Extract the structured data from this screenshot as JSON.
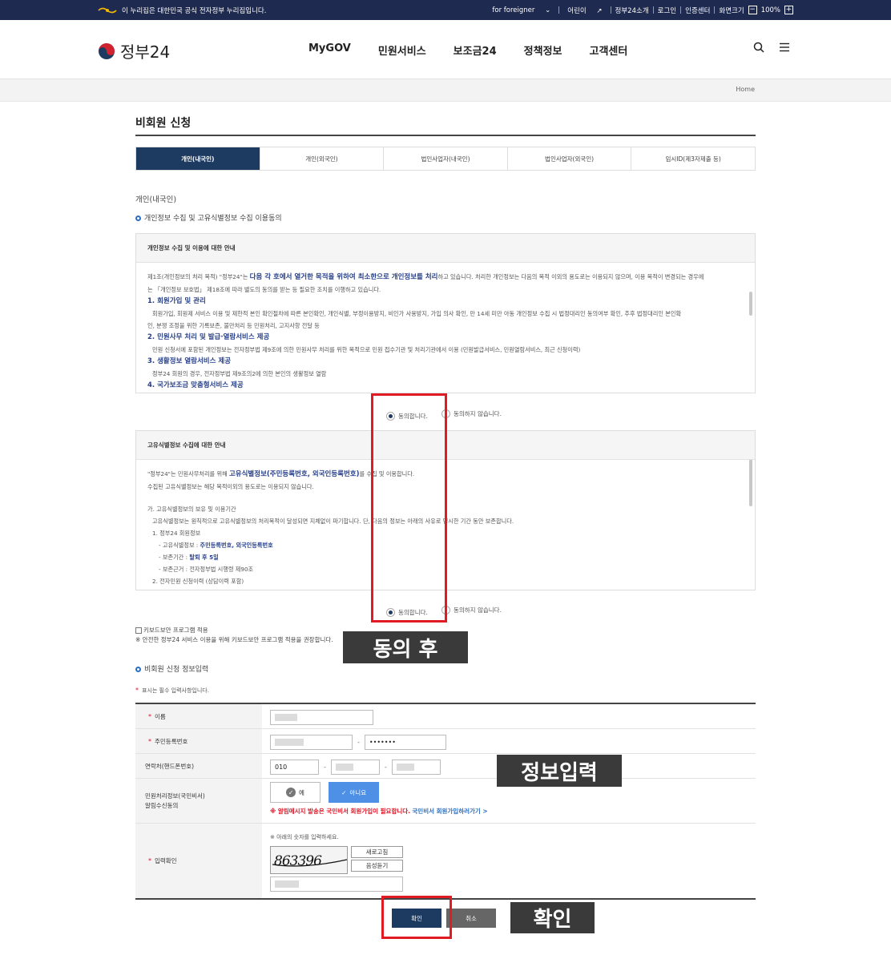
{
  "topbar": {
    "notice": "이 누리집은 대한민국 공식 전자정부 누리집입니다.",
    "foreigner": "for foreigner",
    "kids": "어린이",
    "about": "정부24소개",
    "login": "로그인",
    "cert": "인증센터",
    "zoom_label": "화면크기",
    "zoom_value": "100%",
    "minus": "−",
    "plus": "+"
  },
  "header": {
    "logo": "정부24",
    "menu": [
      "MyGOV",
      "민원서비스",
      "보조금24",
      "정책정보",
      "고객센터"
    ]
  },
  "breadcrumb": "Home",
  "page_title": "비회원 신청",
  "tabs": [
    "개인(내국인)",
    "개인(외국인)",
    "법인사업자(내국인)",
    "법인사업자(외국인)",
    "임시ID(제3자제출 등)"
  ],
  "section": {
    "category": "개인(내국인)",
    "consent_heading": "개인정보 수집 및 고유식별정보 수집 이용동의"
  },
  "box1": {
    "title": "개인정보 수집 및 이용에 대한 안내",
    "p1a": "제1조(개인정보의 처리 목적) \"정부24\"는 ",
    "p1b": "다음 각 호에서 열거한 목적을 위하여 최소한으로 개인정보를 처리",
    "p1c": "하고 있습니다. 처리한 개인정보는 다음의 목적 이외의 용도로는 이용되지 않으며, 이용 목적이 변경되는 경우에",
    "p1d": "는 「개인정보 보호법」 제18조에 따라 별도의 동의를 받는 등 필요한 조치를 이행하고 있습니다.",
    "h1": "1. 회원가입 및 관리",
    "t1a": "회원가입, 회원제 서비스 이용 및 제한적 본인 확인절차에 따른 본인확인, 개인식별, 부정이용방지, 비인가 사용방지, 가입 의사 확인, 만 14세 미만 아동 개인정보 수집 시 법정대리인 동의여부 확인, 추후 법정대리인 본인확",
    "t1b": "인, 분쟁 조정을 위한 기록보존, 불만처리 등 민원처리, 고지사항 전달 등",
    "h2": "2. 민원사무 처리 및 발급·열람서비스 제공",
    "t2": "민원 신청서에 포함된 개인정보는 전자정부법 제9조에 의한 민원사무 처리를 위한 목적으로 민원 접수기관 및 처리기관에서 이용 (민원발급서비스, 민원열람서비스, 최근 신청이력)",
    "h3": "3. 생활정보 열람서비스 제공",
    "t3": "정부24 회원의 경우, 전자정부법 제9조의2에 의한 본인의 생활정보 열람",
    "h4": "4. 국가보조금 맞춤형서비스 제공"
  },
  "box2": {
    "title": "고유식별정보 수집에 대한 안내",
    "p1a": "\"정부24\"는 민원사무처리를 위해 ",
    "p1b": "고유식별정보(주민등록번호, 외국인등록번호)",
    "p1c": "를 수집 및 이용합니다.",
    "p2": "수집된 고유식별정보는 해당 목적이외의 용도로는 이용되지 않습니다.",
    "ga": "가. 고유식별정보의 보유 및 이용기간",
    "ga_t": "고유식별정보는 원칙적으로 고유식별정보의 처리목적이 달성되면 지체없이 파기합니다. 단, 다음의 정보는 아래의 사유로 명시한 기간 동안 보존합니다.",
    "i1": "1. 정부24 회원정보",
    "i1a_l": "- 고유식별정보 : ",
    "i1a_v": "주민등록번호, 외국인등록번호",
    "i1b_l": "- 보존기간 : ",
    "i1b_v": "탈퇴 후 5일",
    "i1c": "- 보존근거 : 전자정부법 시행령 제90조",
    "i2": "2. 전자민원 신청이력 (상담이력 포함)"
  },
  "radio": {
    "agree": "동의합니다.",
    "disagree": "동의하지 않습니다."
  },
  "keyboard": {
    "label": "키보드보안 프로그램 적용",
    "note": "※ 안전한 정부24 서비스 이용을 위해 키보드보안 프로그램 적용을 권장합니다."
  },
  "form": {
    "heading": "비회원 신청 정보입력",
    "required_note": "표시는 필수 입력사항입니다.",
    "req_mark": "*",
    "name_label": "이름",
    "rrn_label": "주민등록번호",
    "rrn_back": "•••••••",
    "phone_label": "연락처(핸드폰번호)",
    "phone_prefix": "010",
    "alert_label_1": "민원처리정보(국민비서)",
    "alert_label_2": "알림수신동의",
    "yes": "예",
    "no": "아니요",
    "alert_warn": "※ 알림메시지 발송은 국민비서 회원가입이 필요합니다.",
    "alert_link": "국민비서 회원가입하러가기 >",
    "captcha_label": "입력확인",
    "captcha_note": "※ 아래의 숫자를 입력하세요.",
    "captcha_text": "863396",
    "refresh": "새로고침",
    "audio": "음성듣기"
  },
  "buttons": {
    "confirm": "확인",
    "cancel": "취소"
  },
  "annotations": {
    "after_consent": "동의 후",
    "info_input": "정보입력",
    "confirm": "확인"
  },
  "colors": {
    "navy": "#1d3b61",
    "topbar": "#1e2a4f",
    "accent_blue": "#27408b",
    "highlight_red": "#e01b24",
    "annot_bg": "#3a3a3a"
  }
}
